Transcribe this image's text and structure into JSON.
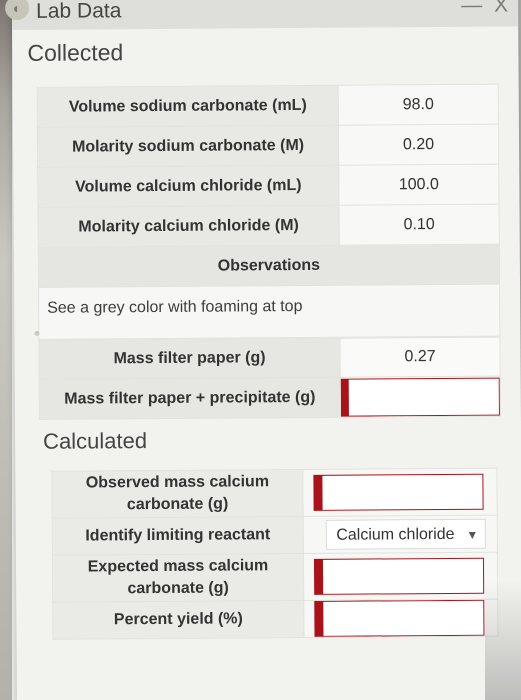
{
  "window": {
    "title": "Lab Data",
    "minimize_glyph": "—",
    "close_glyph": "X"
  },
  "collected": {
    "heading": "Collected",
    "rows": [
      {
        "label": "Volume sodium carbonate (mL)",
        "value": "98.0"
      },
      {
        "label": "Molarity sodium carbonate (M)",
        "value": "0.20"
      },
      {
        "label": "Volume calcium chloride (mL)",
        "value": "100.0"
      },
      {
        "label": "Molarity calcium chloride (M)",
        "value": "0.10"
      }
    ],
    "observations": {
      "heading": "Observations",
      "text": "See a grey color with foaming at top"
    }
  },
  "mass": {
    "rows": [
      {
        "label": "Mass filter paper (g)",
        "value": "0.27"
      },
      {
        "label": "Mass filter paper + precipitate (g)",
        "value": ""
      }
    ]
  },
  "calculated": {
    "heading": "Calculated",
    "rows": [
      {
        "label": "Observed mass calcium carbonate (g)",
        "value": ""
      },
      {
        "label": "Identify limiting reactant",
        "selected": "Calcium chloride"
      },
      {
        "label": "Expected mass calcium carbonate (g)",
        "value": ""
      },
      {
        "label": "Percent yield (%)",
        "value": ""
      }
    ]
  }
}
